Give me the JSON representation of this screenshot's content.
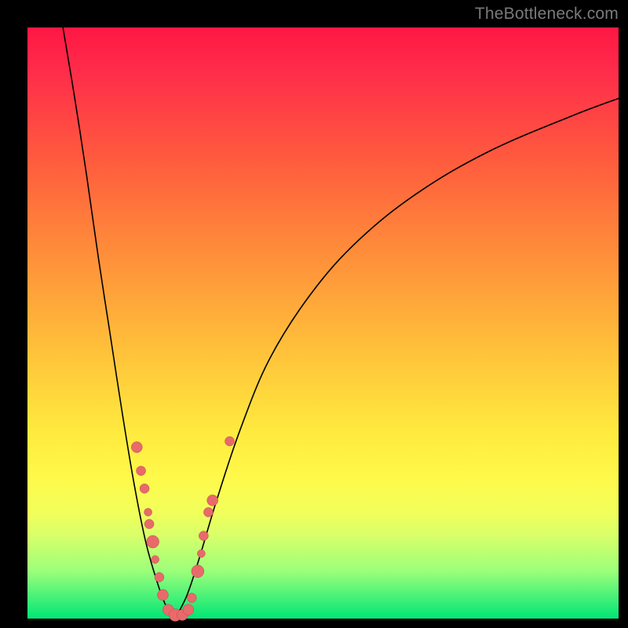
{
  "watermark": "TheBottleneck.com",
  "colors": {
    "frame": "#000000",
    "curve": "#000000",
    "dot_fill": "#e86a6a",
    "dot_stroke": "#b84b4b",
    "gradient_stops": [
      "#ff1744",
      "#ff8a3a",
      "#ffe93e",
      "#00e676"
    ]
  },
  "chart_data": {
    "type": "line",
    "title": "",
    "xlabel": "",
    "ylabel": "",
    "xlim": [
      0,
      100
    ],
    "ylim": [
      0,
      100
    ],
    "grid": false,
    "legend": false,
    "note": "Bottleneck-style V curve. Numeric values are percent of axis range (0=left/bottom, 100=right/top), estimated from pixels.",
    "series": [
      {
        "name": "bottleneck-curve-left",
        "x": [
          6,
          8,
          10,
          12,
          14,
          16,
          18,
          20,
          22,
          23.5,
          25
        ],
        "y": [
          100,
          88,
          75,
          61,
          48,
          35,
          23,
          13,
          6,
          2,
          0
        ]
      },
      {
        "name": "bottleneck-curve-right",
        "x": [
          25,
          27,
          29,
          32,
          36,
          41,
          48,
          56,
          66,
          78,
          92,
          100
        ],
        "y": [
          0,
          4,
          10,
          20,
          32,
          44,
          55,
          64,
          72,
          79,
          85,
          88
        ]
      }
    ],
    "points": {
      "name": "measured-points",
      "comment": "Salmon scatter points clustered near the V minimum. r is marker radius in px.",
      "data": [
        {
          "x": 18.5,
          "y": 29,
          "r": 7
        },
        {
          "x": 19.2,
          "y": 25,
          "r": 6
        },
        {
          "x": 19.8,
          "y": 22,
          "r": 6
        },
        {
          "x": 20.4,
          "y": 18,
          "r": 5
        },
        {
          "x": 20.6,
          "y": 16,
          "r": 6
        },
        {
          "x": 21.2,
          "y": 13,
          "r": 8
        },
        {
          "x": 21.6,
          "y": 10,
          "r": 5
        },
        {
          "x": 22.3,
          "y": 7,
          "r": 6
        },
        {
          "x": 22.9,
          "y": 4,
          "r": 7
        },
        {
          "x": 23.8,
          "y": 1.5,
          "r": 7
        },
        {
          "x": 25.0,
          "y": 0.6,
          "r": 8
        },
        {
          "x": 26.2,
          "y": 0.6,
          "r": 7
        },
        {
          "x": 27.2,
          "y": 1.5,
          "r": 7
        },
        {
          "x": 27.8,
          "y": 3.5,
          "r": 6
        },
        {
          "x": 28.8,
          "y": 8,
          "r": 8
        },
        {
          "x": 29.4,
          "y": 11,
          "r": 5
        },
        {
          "x": 29.8,
          "y": 14,
          "r": 6
        },
        {
          "x": 30.6,
          "y": 18,
          "r": 6
        },
        {
          "x": 31.3,
          "y": 20,
          "r": 7
        },
        {
          "x": 34.2,
          "y": 30,
          "r": 6
        }
      ]
    }
  }
}
